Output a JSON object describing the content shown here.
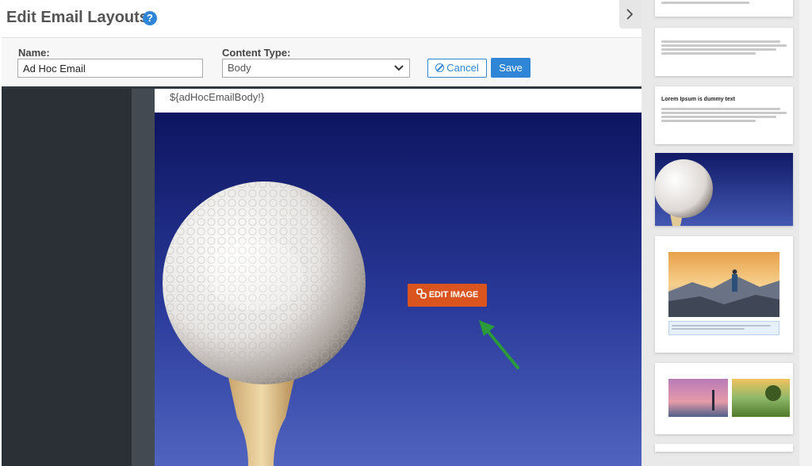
{
  "header": {
    "title": "Edit Email Layouts",
    "help_icon": "question-circle-icon",
    "help_glyph": "?"
  },
  "form": {
    "name_label": "Name:",
    "name_value": "Ad Hoc Email",
    "content_type_label": "Content Type:",
    "content_type_value": "Body",
    "cancel_label": "Cancel",
    "save_label": "Save"
  },
  "editor": {
    "merge_tag": "${adHocEmailBody!}",
    "edit_image_label": "EDIT IMAGE"
  },
  "template_panel": {
    "thumbnails": [
      {
        "kind": "text-lines",
        "heading": ""
      },
      {
        "kind": "text-lines",
        "heading": ""
      },
      {
        "kind": "heading-text",
        "heading": "Lorem Ipsum is dummy text"
      },
      {
        "kind": "image-golf",
        "heading": ""
      },
      {
        "kind": "image-caption",
        "heading": ""
      },
      {
        "kind": "two-images",
        "heading": ""
      }
    ]
  },
  "colors": {
    "accent_blue": "#2f86d6",
    "edit_button": "#d9541e",
    "arrow_green": "#2a9a3a",
    "editor_dark": "#2a3036"
  }
}
